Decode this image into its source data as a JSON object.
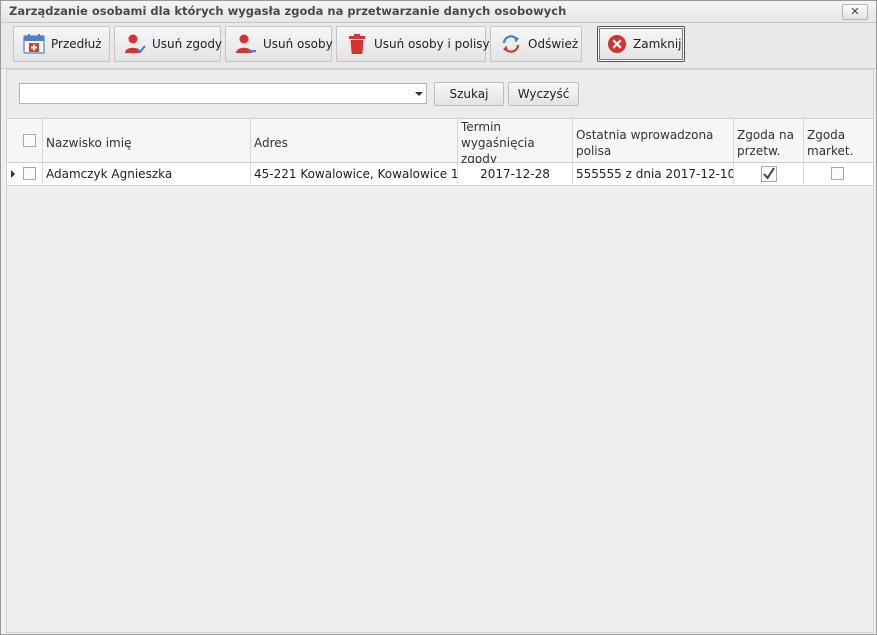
{
  "window": {
    "title": "Zarządzanie osobami dla których wygasła zgoda na przetwarzanie danych osobowych",
    "close_glyph": "✕"
  },
  "toolbar": {
    "buttons": [
      {
        "label": "Przedłuż",
        "icon": "calendar-plus-icon"
      },
      {
        "label": "Usuń zgody",
        "icon": "user-check-icon"
      },
      {
        "label": "Usuń osoby",
        "icon": "user-remove-icon"
      },
      {
        "label": "Usuń osoby i polisy",
        "icon": "trash-icon"
      },
      {
        "label": "Odśwież",
        "icon": "refresh-icon"
      },
      {
        "label": "Zamknij",
        "icon": "close-circle-icon"
      }
    ]
  },
  "search": {
    "value": "",
    "search_label": "Szukaj",
    "clear_label": "Wyczyść"
  },
  "grid": {
    "columns": [
      {
        "label": "Nazwisko imię"
      },
      {
        "label": "Adres"
      },
      {
        "label": "Termin wygaśnięcia zgody"
      },
      {
        "label": "Ostatnia wprowadzona polisa"
      },
      {
        "label": "Zgoda na przetw."
      },
      {
        "label": "Zgoda market."
      }
    ],
    "rows": [
      {
        "selected": false,
        "name": "Adamczyk Agnieszka",
        "address": "45-221 Kowalowice, Kowalowice 1",
        "expiry": "2017-12-28",
        "policy": "555555 z dnia 2017-12-10",
        "consent_processing": true,
        "consent_marketing": false
      }
    ]
  },
  "colors": {
    "accent_red": "#d9312b",
    "accent_blue": "#3b7fd4"
  }
}
